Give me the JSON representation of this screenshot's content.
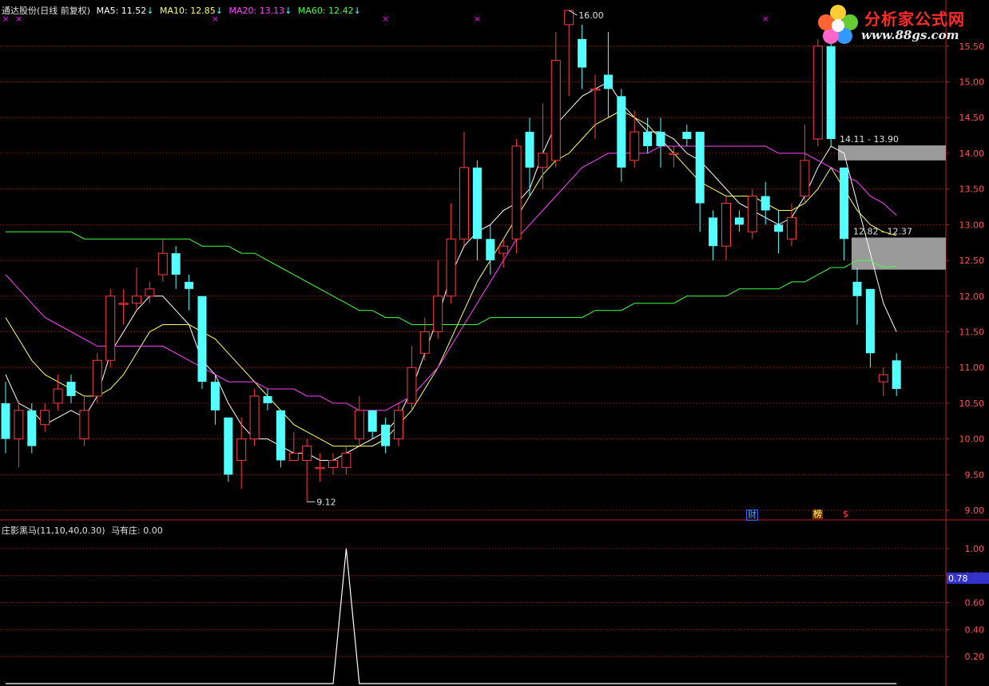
{
  "header": {
    "stock_name": "通达股份",
    "period": "(日线 前复权)",
    "ma5": "MA5: 11.52",
    "ma10": "MA10: 12.85",
    "ma20": "MA20: 13.13",
    "ma60": "MA60: 12.42",
    "arrow": "↓"
  },
  "indicator_header": {
    "name": "庄影黑马(11,10,40,0.30)",
    "value": "马有庄: 0.00"
  },
  "logo": {
    "title": "分析家公式网",
    "url": "www.88gs.com"
  },
  "colors": {
    "up": "#ff3d3d",
    "down": "#54ffff",
    "ma5": "#ffffff",
    "ma10": "#ffff66",
    "ma20": "#ff44ff",
    "ma60": "#44ff44",
    "grid": "#a02020",
    "axis": "#c02020",
    "marker": "#ff00ff",
    "highlight": "#3333cc"
  },
  "badges": {
    "cai": "财",
    "bang": "榜",
    "dollar": "$"
  },
  "chart_data": [
    {
      "type": "candlestick",
      "title": "通达股份(日线 前复权)",
      "ylim": [
        8.9,
        15.9
      ],
      "yticks": [
        "15.50",
        "15.00",
        "14.50",
        "14.00",
        "13.50",
        "13.00",
        "12.50",
        "12.00",
        "11.50",
        "11.00",
        "10.50",
        "10.00",
        "9.50",
        "9.00"
      ],
      "high_label": "16.00",
      "low_label": "9.12",
      "zone_labels": [
        "14.11 - 13.90",
        "12.82 - 12.37"
      ],
      "zones": [
        [
          14.11,
          13.9
        ],
        [
          12.82,
          12.37
        ]
      ],
      "candles": [
        [
          10.5,
          10.0,
          10.8,
          9.8
        ],
        [
          10.0,
          10.4,
          10.5,
          9.6
        ],
        [
          10.4,
          9.9,
          10.5,
          9.8
        ],
        [
          10.2,
          10.4,
          10.5,
          10.1
        ],
        [
          10.5,
          10.7,
          10.9,
          10.4
        ],
        [
          10.8,
          10.6,
          10.9,
          10.5
        ],
        [
          10.0,
          10.4,
          10.6,
          9.9
        ],
        [
          10.6,
          11.1,
          11.2,
          10.5
        ],
        [
          11.1,
          12.0,
          12.1,
          11.0
        ],
        [
          11.9,
          11.9,
          12.1,
          11.6
        ],
        [
          11.9,
          12.0,
          12.4,
          11.8
        ],
        [
          12.0,
          12.1,
          12.2,
          11.9
        ],
        [
          12.3,
          12.6,
          12.8,
          12.2
        ],
        [
          12.6,
          12.3,
          12.7,
          12.1
        ],
        [
          12.2,
          12.1,
          12.3,
          11.8
        ],
        [
          12.0,
          10.8,
          12.0,
          10.7
        ],
        [
          10.8,
          10.4,
          10.9,
          10.2
        ],
        [
          10.3,
          9.5,
          10.3,
          9.4
        ],
        [
          9.7,
          10.0,
          10.3,
          9.3
        ],
        [
          10.0,
          10.6,
          10.7,
          9.9
        ],
        [
          10.6,
          10.5,
          10.7,
          10.4
        ],
        [
          10.4,
          9.7,
          10.4,
          9.6
        ],
        [
          9.7,
          9.8,
          10.1,
          9.7
        ],
        [
          9.7,
          9.9,
          10.0,
          9.12
        ],
        [
          9.6,
          9.6,
          9.8,
          9.4
        ],
        [
          9.6,
          9.7,
          9.8,
          9.5
        ],
        [
          9.6,
          9.8,
          9.9,
          9.5
        ],
        [
          10.0,
          10.4,
          10.6,
          9.9
        ],
        [
          10.4,
          10.1,
          10.4,
          10.0
        ],
        [
          10.2,
          9.9,
          10.3,
          9.8
        ],
        [
          10.0,
          10.4,
          10.5,
          9.9
        ],
        [
          10.5,
          11.0,
          11.3,
          10.4
        ],
        [
          11.2,
          11.5,
          11.7,
          11.1
        ],
        [
          11.5,
          12.0,
          12.5,
          11.4
        ],
        [
          12.0,
          12.8,
          13.3,
          11.9
        ],
        [
          12.8,
          13.8,
          14.3,
          12.7
        ],
        [
          13.8,
          12.8,
          13.9,
          12.5
        ],
        [
          12.8,
          12.5,
          13.0,
          12.3
        ],
        [
          12.6,
          12.7,
          12.8,
          12.4
        ],
        [
          12.8,
          14.1,
          14.2,
          12.6
        ],
        [
          14.3,
          13.8,
          14.5,
          13.4
        ],
        [
          13.8,
          14.0,
          14.7,
          13.5
        ],
        [
          13.9,
          15.3,
          15.7,
          13.8
        ],
        [
          15.8,
          16.0,
          16.0,
          14.8
        ],
        [
          15.6,
          15.2,
          15.8,
          14.9
        ],
        [
          14.9,
          14.9,
          15.1,
          14.2
        ],
        [
          15.1,
          14.9,
          15.7,
          14.5
        ],
        [
          14.8,
          13.8,
          14.9,
          13.6
        ],
        [
          13.9,
          14.3,
          14.6,
          13.8
        ],
        [
          14.3,
          14.1,
          14.5,
          14.0
        ],
        [
          14.3,
          14.1,
          14.5,
          13.8
        ],
        [
          14.0,
          14.0,
          14.1,
          13.8
        ],
        [
          14.3,
          14.2,
          14.4,
          14.1
        ],
        [
          14.3,
          13.3,
          14.3,
          12.9
        ],
        [
          13.1,
          12.7,
          13.2,
          12.5
        ],
        [
          12.7,
          13.3,
          13.4,
          12.5
        ],
        [
          13.1,
          13.0,
          13.2,
          12.9
        ],
        [
          12.9,
          13.4,
          13.5,
          12.8
        ],
        [
          13.4,
          13.2,
          13.6,
          13.0
        ],
        [
          13.0,
          12.9,
          13.2,
          12.6
        ],
        [
          12.8,
          13.1,
          13.3,
          12.7
        ],
        [
          13.4,
          13.9,
          14.4,
          13.3
        ],
        [
          14.2,
          15.5,
          15.6,
          14.1
        ],
        [
          15.5,
          14.2,
          15.6,
          14.1
        ],
        [
          13.8,
          12.8,
          13.8,
          12.5
        ],
        [
          12.2,
          12.0,
          12.4,
          11.6
        ],
        [
          12.1,
          11.2,
          12.1,
          11.0
        ],
        [
          10.8,
          10.9,
          11.0,
          10.6
        ],
        [
          11.1,
          10.7,
          11.2,
          10.6
        ]
      ],
      "ma_series": [
        {
          "name": "MA5",
          "values": [
            10.9,
            10.5,
            10.4,
            10.2,
            10.3,
            10.4,
            10.3,
            10.6,
            11.2,
            11.5,
            11.8,
            12.0,
            12.0,
            11.8,
            11.6,
            11.1,
            10.9,
            10.5,
            10.2,
            10.0,
            10.0,
            9.9,
            9.8,
            9.8,
            9.7,
            9.7,
            9.8,
            9.9,
            10.0,
            10.1,
            10.3,
            10.7,
            11.2,
            11.7,
            12.3,
            12.7,
            12.9,
            13.0,
            13.2,
            13.3,
            13.5,
            14.0,
            14.4,
            14.6,
            14.8,
            14.9,
            15.0,
            14.7,
            14.5,
            14.3,
            14.3,
            14.2,
            14.0,
            13.9,
            13.7,
            13.5,
            13.3,
            13.2,
            13.1,
            13.0,
            13.1,
            13.4,
            13.8,
            14.1,
            14.0,
            13.3,
            12.6,
            11.9,
            11.5
          ]
        },
        {
          "name": "MA10",
          "values": [
            11.7,
            11.4,
            11.1,
            10.9,
            10.8,
            10.7,
            10.6,
            10.6,
            10.7,
            10.9,
            11.2,
            11.5,
            11.6,
            11.6,
            11.6,
            11.5,
            11.4,
            11.2,
            11.0,
            10.8,
            10.6,
            10.4,
            10.2,
            10.1,
            10.0,
            9.9,
            9.9,
            9.9,
            9.9,
            10.0,
            10.2,
            10.4,
            10.7,
            11.0,
            11.4,
            11.8,
            12.2,
            12.5,
            12.8,
            13.1,
            13.4,
            13.7,
            13.9,
            14.0,
            14.2,
            14.4,
            14.5,
            14.6,
            14.5,
            14.4,
            14.2,
            14.0,
            13.8,
            13.6,
            13.5,
            13.4,
            13.4,
            13.4,
            13.3,
            13.2,
            13.2,
            13.3,
            13.5,
            13.8,
            13.5,
            13.2,
            13.0,
            12.9,
            12.85
          ]
        },
        {
          "name": "MA20",
          "values": [
            12.3,
            12.1,
            11.9,
            11.7,
            11.6,
            11.5,
            11.4,
            11.3,
            11.3,
            11.3,
            11.3,
            11.3,
            11.3,
            11.2,
            11.1,
            11.0,
            10.9,
            10.8,
            10.8,
            10.8,
            10.7,
            10.7,
            10.7,
            10.6,
            10.6,
            10.5,
            10.5,
            10.4,
            10.4,
            10.4,
            10.5,
            10.6,
            10.8,
            11.0,
            11.3,
            11.6,
            11.9,
            12.2,
            12.5,
            12.8,
            13.0,
            13.2,
            13.4,
            13.6,
            13.8,
            13.9,
            14.0,
            14.0,
            14.0,
            14.0,
            14.1,
            14.1,
            14.1,
            14.1,
            14.1,
            14.1,
            14.1,
            14.1,
            14.1,
            14.0,
            14.0,
            14.0,
            13.9,
            13.8,
            13.7,
            13.6,
            13.4,
            13.3,
            13.13
          ]
        },
        {
          "name": "MA60",
          "values": [
            12.9,
            12.9,
            12.9,
            12.9,
            12.9,
            12.9,
            12.8,
            12.8,
            12.8,
            12.8,
            12.8,
            12.8,
            12.8,
            12.8,
            12.8,
            12.7,
            12.7,
            12.7,
            12.6,
            12.6,
            12.5,
            12.4,
            12.3,
            12.2,
            12.1,
            12.0,
            11.9,
            11.8,
            11.8,
            11.7,
            11.7,
            11.6,
            11.6,
            11.6,
            11.6,
            11.6,
            11.6,
            11.7,
            11.7,
            11.7,
            11.7,
            11.7,
            11.7,
            11.7,
            11.7,
            11.8,
            11.8,
            11.8,
            11.9,
            11.9,
            11.9,
            11.9,
            12.0,
            12.0,
            12.0,
            12.0,
            12.1,
            12.1,
            12.1,
            12.1,
            12.2,
            12.2,
            12.3,
            12.4,
            12.4,
            12.5,
            12.5,
            12.4,
            12.42
          ]
        }
      ],
      "markers_top": [
        0,
        1,
        16,
        29,
        36,
        58
      ],
      "badge_positions": [
        58,
        63,
        65
      ]
    },
    {
      "type": "line",
      "title": "庄影黑马(11,10,40,0.30)",
      "ylim": [
        0,
        1.2
      ],
      "yticks": [
        "1.00",
        "0.80",
        "0.60",
        "0.40",
        "0.20"
      ],
      "current_value_label": "0.78",
      "current_value": 0.78,
      "series": [
        {
          "name": "马有庄",
          "values": [
            0,
            0,
            0,
            0,
            0,
            0,
            0,
            0,
            0,
            0,
            0,
            0,
            0,
            0,
            0,
            0,
            0,
            0,
            0,
            0,
            0,
            0,
            0,
            0,
            0,
            0,
            1,
            0,
            0,
            0,
            0,
            0,
            0,
            0,
            0,
            0,
            0,
            0,
            0,
            0,
            0,
            0,
            0,
            0,
            0,
            0,
            0,
            0,
            0,
            0,
            0,
            0,
            0,
            0,
            0,
            0,
            0,
            0,
            0,
            0,
            0,
            0,
            0,
            0,
            0,
            0,
            0,
            0,
            0
          ]
        }
      ]
    }
  ]
}
